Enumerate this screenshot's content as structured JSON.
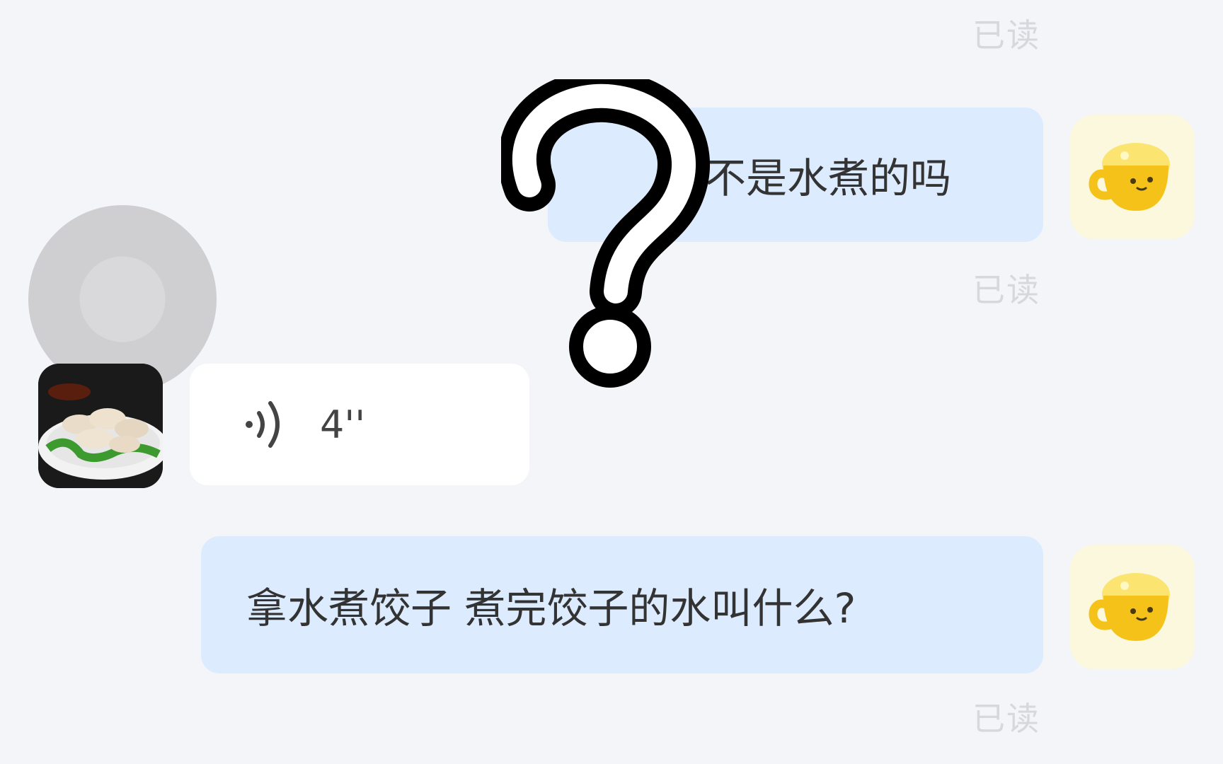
{
  "chat": {
    "read_label": "已读",
    "messages": [
      {
        "direction": "out",
        "type": "text",
        "text": "不是水煮的吗"
      },
      {
        "direction": "in",
        "type": "voice",
        "duration": "4''"
      },
      {
        "direction": "out",
        "type": "text",
        "text": "拿水煮饺子 煮完饺子的水叫什么?"
      }
    ]
  },
  "icons": {
    "self_avatar": "mug-face-icon",
    "peer_avatar": "dumplings-photo",
    "voice": "voice-wave-icon",
    "overlay": "question-mark-icon"
  },
  "colors": {
    "background": "#f3f5f9",
    "outgoing_bubble": "#dcebfd",
    "incoming_bubble": "#ffffff",
    "read_text": "#d6d8dd",
    "mug_yellow": "#f5c21a"
  }
}
